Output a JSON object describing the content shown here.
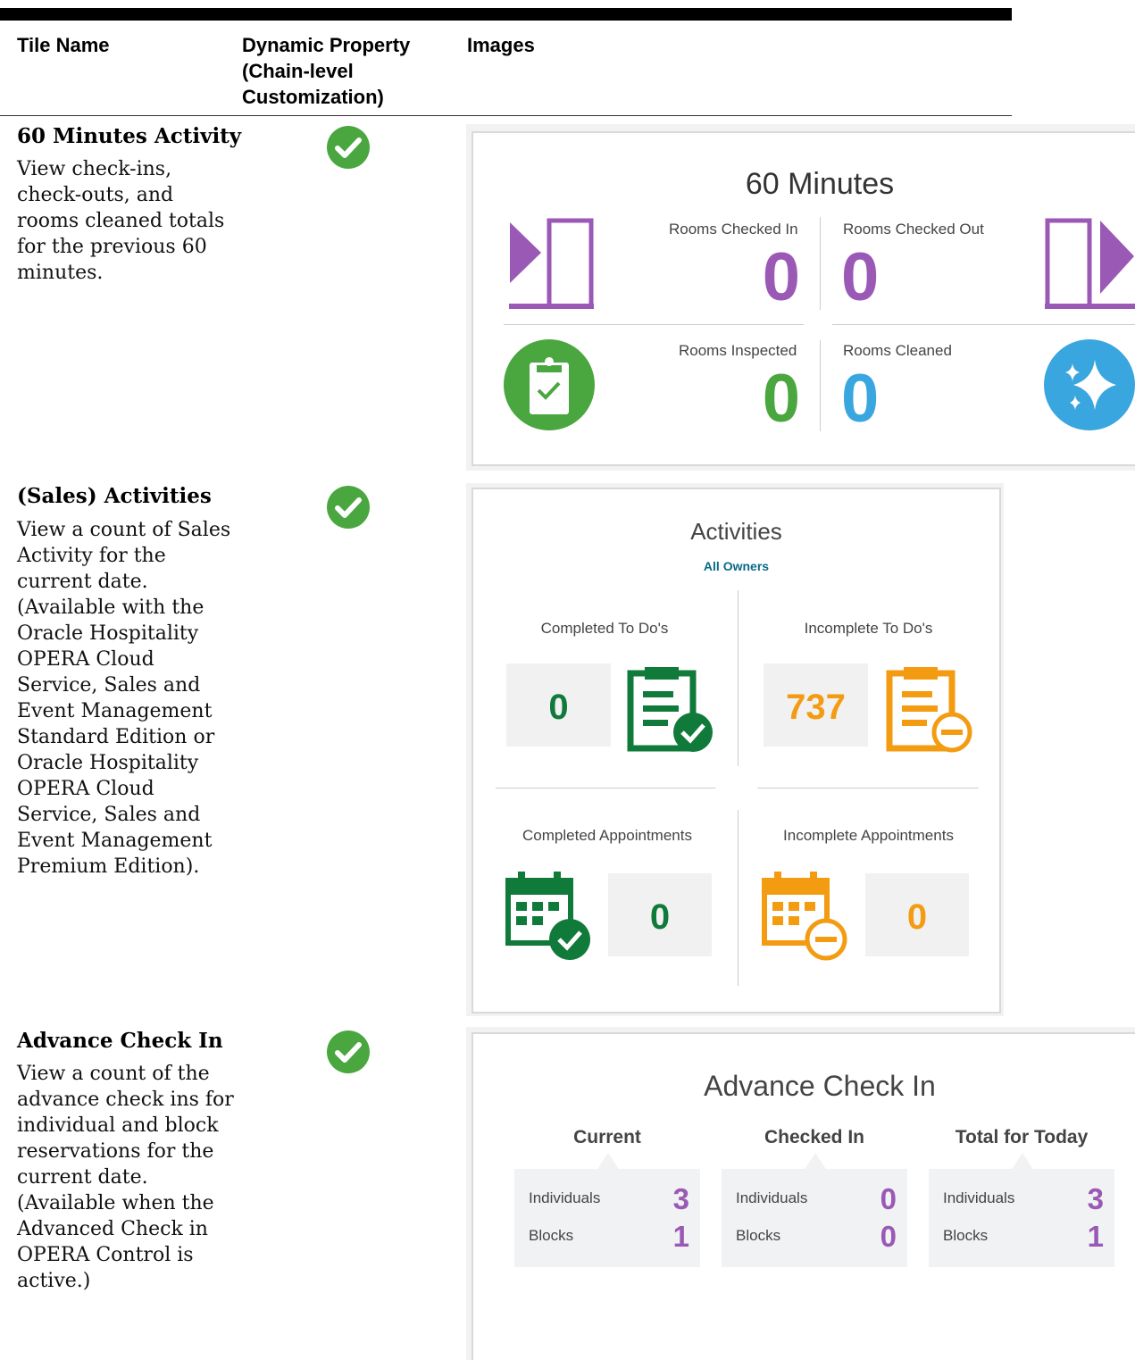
{
  "table": {
    "headers": [
      "Tile Name",
      "Dynamic Property (Chain-level Customization)",
      "Images"
    ],
    "rows": [
      {
        "title": "60 Minutes Activity",
        "description": "View check-ins, check-outs, and rooms cleaned totals for the previous 60 minutes.",
        "dynamic": true
      },
      {
        "title": "(Sales) Activities",
        "description": "View a count of Sales Activity for the current date. (Available with the Oracle Hospitality OPERA Cloud Service, Sales and Event Management Standard Edition or Oracle Hospitality OPERA Cloud Service, Sales and Event Management Premium Edition).",
        "dynamic": true
      },
      {
        "title": "Advance Check In",
        "description": "View a count of the advance check ins for individual and block reservations for the current date. (Available when the Advanced Check in OPERA Control is active.)",
        "dynamic": true
      }
    ]
  },
  "tile_60min": {
    "title": "60 Minutes",
    "checked_in_label": "Rooms Checked In",
    "checked_in_value": "0",
    "checked_out_label": "Rooms Checked Out",
    "checked_out_value": "0",
    "inspected_label": "Rooms Inspected",
    "inspected_value": "0",
    "cleaned_label": "Rooms Cleaned",
    "cleaned_value": "0"
  },
  "tile_activities": {
    "title": "Activities",
    "owner_filter": "All Owners",
    "completed_todos_label": "Completed To Do's",
    "completed_todos_value": "0",
    "incomplete_todos_label": "Incomplete To Do's",
    "incomplete_todos_value": "737",
    "completed_appts_label": "Completed Appointments",
    "completed_appts_value": "0",
    "incomplete_appts_label": "Incomplete Appointments",
    "incomplete_appts_value": "0"
  },
  "tile_advance": {
    "title": "Advance Check In",
    "groups": [
      {
        "heading": "Current",
        "individuals_label": "Individuals",
        "individuals": "3",
        "blocks_label": "Blocks",
        "blocks": "1"
      },
      {
        "heading": "Checked In",
        "individuals_label": "Individuals",
        "individuals": "0",
        "blocks_label": "Blocks",
        "blocks": "0"
      },
      {
        "heading": "Total for Today",
        "individuals_label": "Individuals",
        "individuals": "3",
        "blocks_label": "Blocks",
        "blocks": "1"
      }
    ]
  },
  "colors": {
    "purple": "#9b59b6",
    "green": "#4aa63f",
    "blue": "#3aa6df",
    "dark_green": "#107a3a",
    "orange": "#f39c12",
    "teal_link": "#0a6a8a"
  },
  "icons": [
    "check-circle-icon",
    "door-enter-icon",
    "door-exit-icon",
    "clipboard-check-icon",
    "sparkle-icon",
    "clipboard-complete-icon",
    "clipboard-minus-icon",
    "calendar-check-icon",
    "calendar-minus-icon"
  ]
}
